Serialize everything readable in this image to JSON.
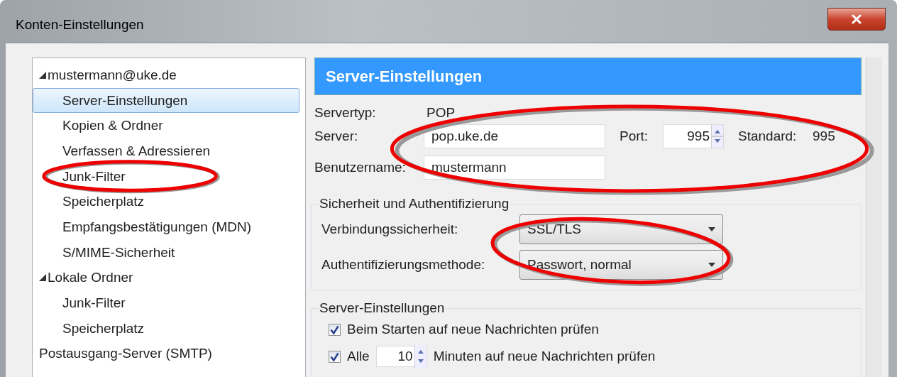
{
  "window": {
    "title": "Konten-Einstellungen"
  },
  "tree": [
    {
      "label": "mustermann@uke.de",
      "expanded": true,
      "selected": false,
      "highlighted": false,
      "children": [
        {
          "label": "Server-Einstellungen",
          "selected": true,
          "highlighted": false
        },
        {
          "label": "Kopien & Ordner",
          "selected": false,
          "highlighted": false
        },
        {
          "label": "Verfassen & Adressieren",
          "selected": false,
          "highlighted": false
        },
        {
          "label": "Junk-Filter",
          "selected": false,
          "highlighted": true
        },
        {
          "label": "Speicherplatz",
          "selected": false,
          "highlighted": false
        },
        {
          "label": "Empfangsbestätigungen (MDN)",
          "selected": false,
          "highlighted": false
        },
        {
          "label": "S/MIME-Sicherheit",
          "selected": false,
          "highlighted": false
        }
      ]
    },
    {
      "label": "Lokale Ordner",
      "expanded": true,
      "selected": false,
      "highlighted": false,
      "children": [
        {
          "label": "Junk-Filter",
          "selected": false,
          "highlighted": false
        },
        {
          "label": "Speicherplatz",
          "selected": false,
          "highlighted": false
        }
      ]
    },
    {
      "label": "Postausgang-Server (SMTP)",
      "selected": false,
      "highlighted": false
    }
  ],
  "header": "Server-Einstellungen",
  "server_type": {
    "label": "Servertyp:",
    "value": "POP"
  },
  "server_fields": {
    "highlighted": true,
    "server": {
      "label": "Server:",
      "value": "pop.uke.de"
    },
    "port": {
      "label": "Port:",
      "value": "995"
    },
    "default": {
      "label": "Standard:",
      "value": "995"
    },
    "username": {
      "label": "Benutzername:",
      "value": "mustermann"
    }
  },
  "security": {
    "legend": "Sicherheit und Authentifizierung",
    "highlighted": true,
    "dropdowns": [
      {
        "label": "Verbindungssicherheit:",
        "value": "SSL/TLS"
      },
      {
        "label": "Authentifizierungsmethode:",
        "value": "Passwort, normal"
      }
    ]
  },
  "server_settings": {
    "legend": "Server-Einstellungen",
    "options": [
      {
        "kind": "checkbox",
        "label": "Beim Starten auf neue Nachrichten prüfen",
        "checked": true
      },
      {
        "kind": "interval",
        "label_before": "Alle",
        "value": "10",
        "label_after": "Minuten auf neue Nachrichten prüfen",
        "checked": true
      }
    ]
  }
}
